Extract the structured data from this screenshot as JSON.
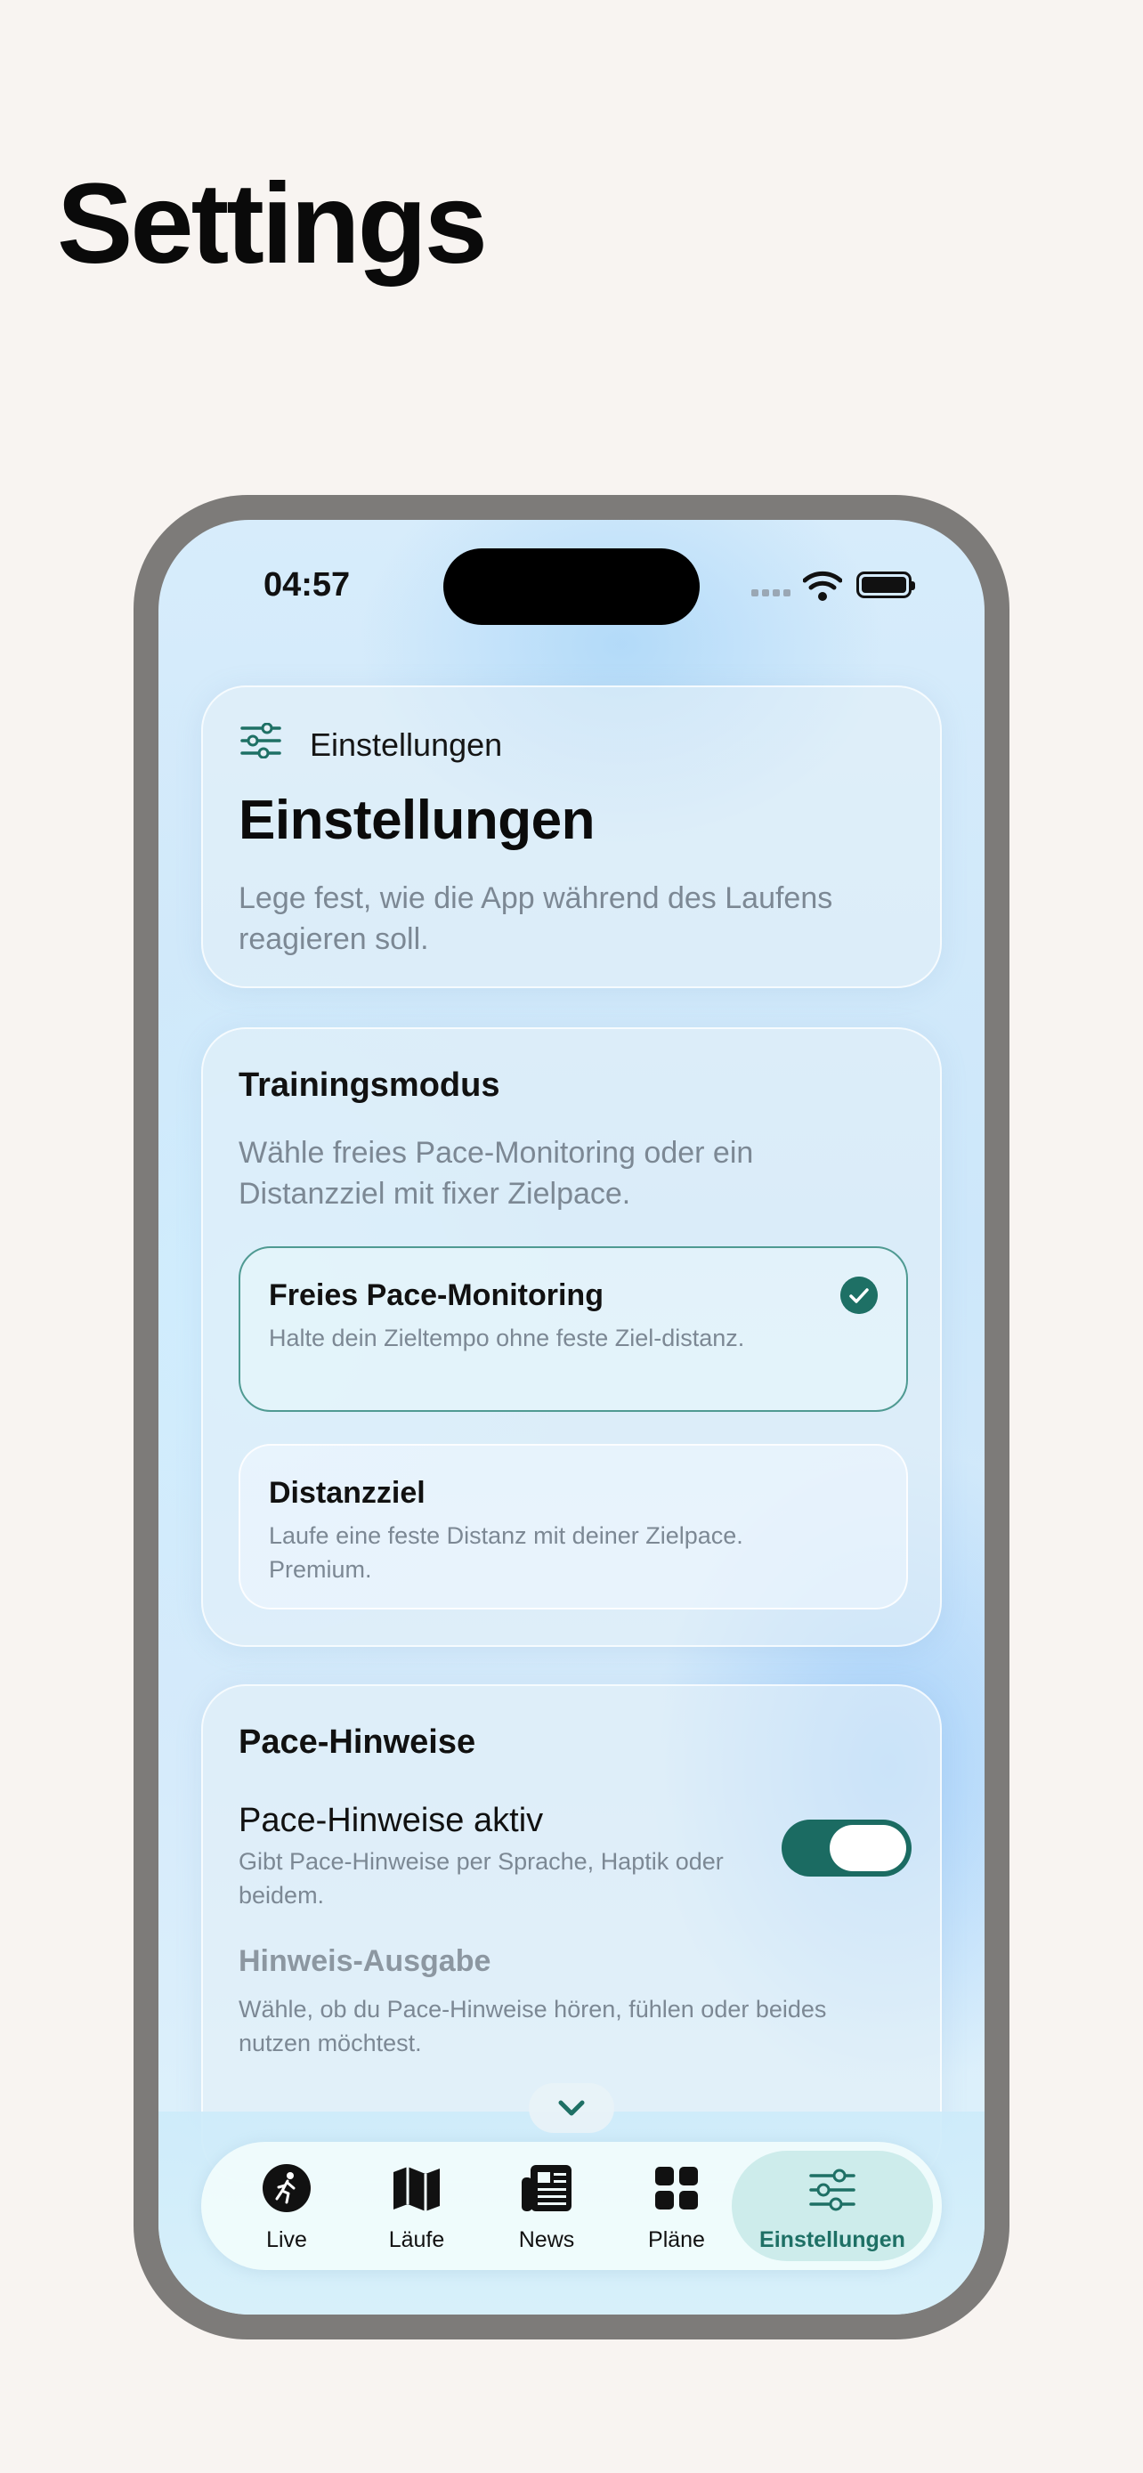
{
  "page": {
    "title": "Settings"
  },
  "status": {
    "time": "04:57"
  },
  "header_card": {
    "small_label": "Einstellungen",
    "title": "Einstellungen",
    "subtitle": "Lege fest, wie die App während des Laufens reagieren soll."
  },
  "training": {
    "title": "Trainingsmodus",
    "description": "Wähle freies Pace-Monitoring oder ein Distanzziel mit fixer Zielpace.",
    "options": [
      {
        "title": "Freies Pace-Monitoring",
        "description": "Halte dein Zieltempo ohne feste Ziel-distanz.",
        "selected": true
      },
      {
        "title": "Distanzziel",
        "description": "Laufe eine feste Distanz mit deiner Zielpace. Premium.",
        "selected": false
      }
    ]
  },
  "pace": {
    "title": "Pace-Hinweise",
    "toggle_label": "Pace-Hinweise aktiv",
    "toggle_description": "Gibt Pace-Hinweise per Sprache, Haptik oder beidem.",
    "toggle_on": true,
    "output_heading": "Hinweis-Ausgabe",
    "output_description": "Wähle, ob du Pace-Hinweise hören, fühlen oder beides nutzen möchtest."
  },
  "tabs": [
    {
      "label": "Live",
      "icon": "running-person-icon"
    },
    {
      "label": "Läufe",
      "icon": "map-icon"
    },
    {
      "label": "News",
      "icon": "newspaper-icon"
    },
    {
      "label": "Pläne",
      "icon": "grid-icon"
    },
    {
      "label": "Einstellungen",
      "icon": "sliders-icon",
      "active": true
    }
  ],
  "colors": {
    "accent": "#1e7065",
    "background": "#f8f4f1"
  }
}
